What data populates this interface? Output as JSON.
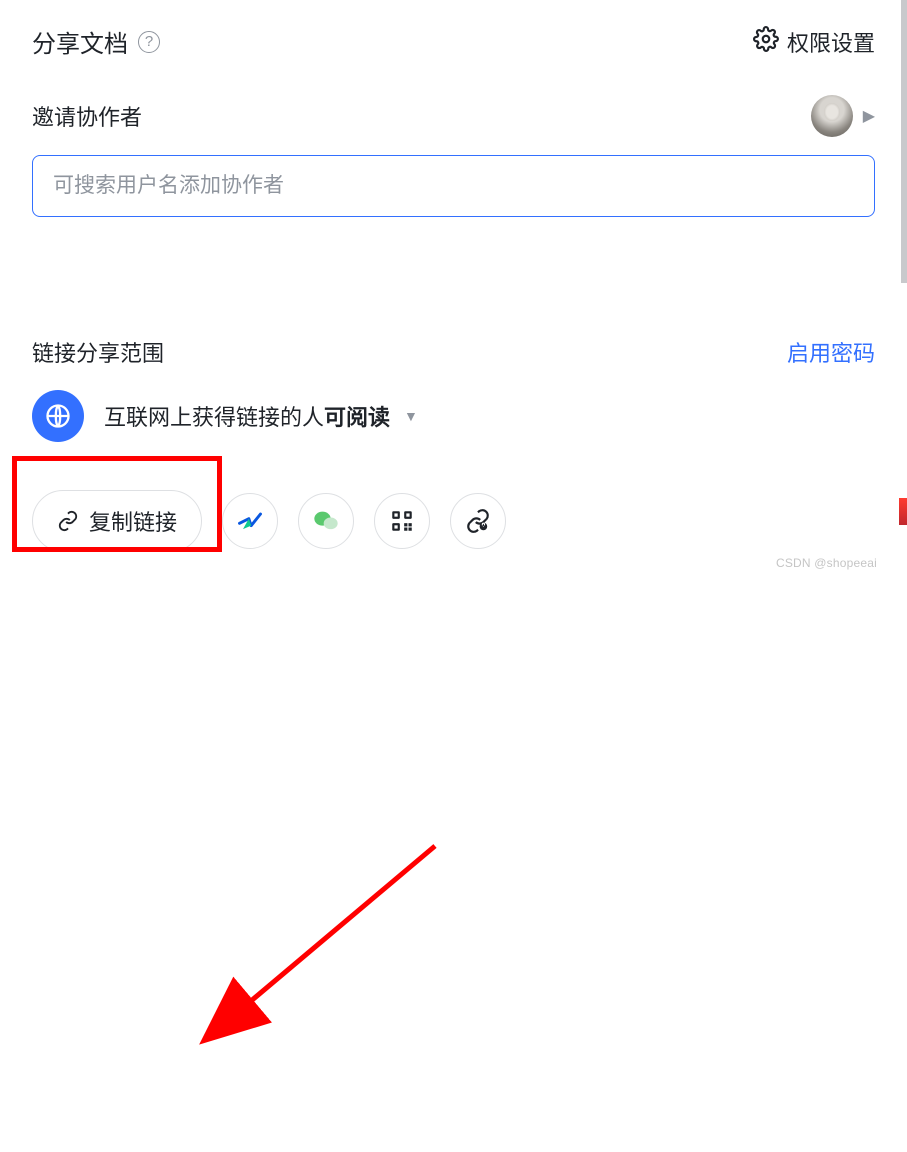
{
  "header": {
    "title": "分享文档",
    "permissions_label": "权限设置"
  },
  "collaborators": {
    "label": "邀请协作者",
    "search_placeholder": "可搜索用户名添加协作者"
  },
  "share_scope": {
    "label": "链接分享范围",
    "enable_password": "启用密码",
    "scope_prefix": "互联网上获得链接的人",
    "scope_permission": "可阅读"
  },
  "actions": {
    "copy_link": "复制链接"
  },
  "watermark": "CSDN @shopeeai"
}
